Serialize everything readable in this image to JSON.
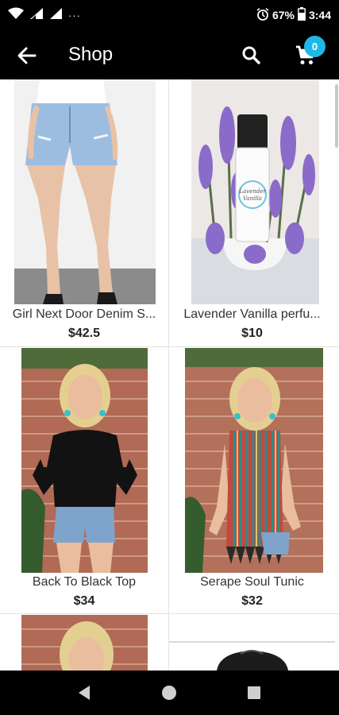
{
  "status_bar": {
    "battery": "67%",
    "time": "3:44",
    "overflow": "···"
  },
  "app_bar": {
    "title": "Shop",
    "cart_count": "0"
  },
  "products": [
    {
      "name": "Girl Next Door Denim S...",
      "price": "$42.5"
    },
    {
      "name": "Lavender Vanilla perfu...",
      "price": "$10"
    },
    {
      "name": "Back To Black Top",
      "price": "$34"
    },
    {
      "name": "Serape Soul Tunic",
      "price": "$32"
    }
  ],
  "image_text": {
    "bottle_label": "Lavender Vanilla"
  },
  "colors": {
    "bar": "#000000",
    "badge": "#1fb8e6"
  },
  "icons": [
    "wifi-icon",
    "signal-icon",
    "alarm-icon",
    "battery-icon",
    "back-arrow-icon",
    "search-icon",
    "cart-icon",
    "nav-back-icon",
    "nav-home-icon",
    "nav-recents-icon"
  ]
}
